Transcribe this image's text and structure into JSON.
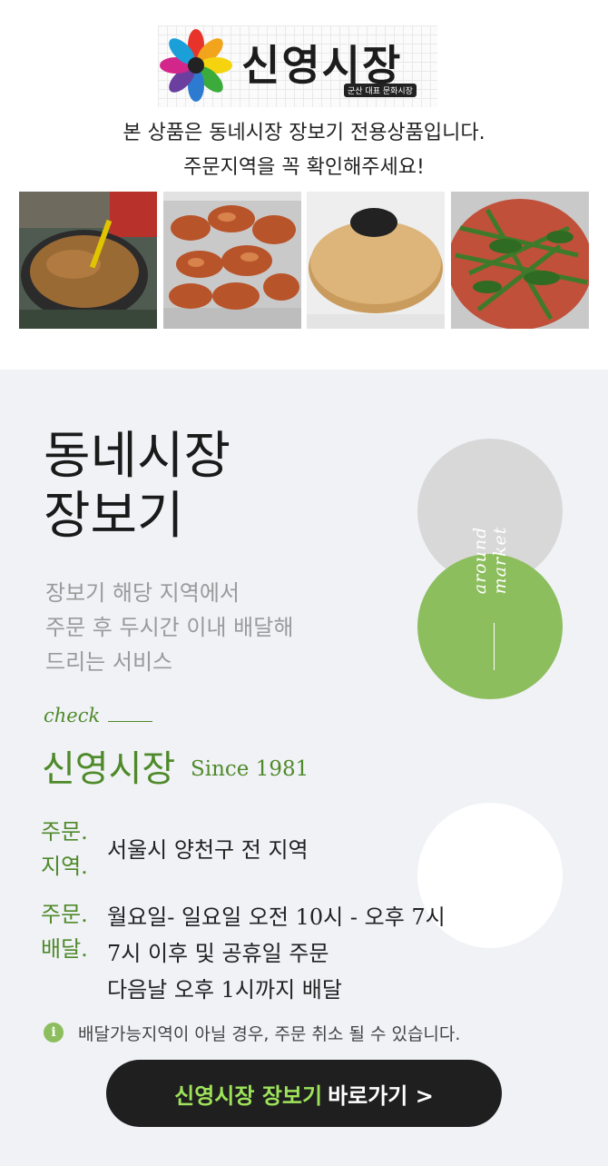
{
  "logo": {
    "text": "신영시장",
    "tag": "군산 대표 문화시장"
  },
  "notice": {
    "line1": "본 상품은 동네시장 장보기 전용상품입니다.",
    "line2": "주문지역을 꼭 확인해주세요!"
  },
  "photos": [
    "seasoning-paste",
    "fried-chicken-gangjeong",
    "sesame-bread",
    "greens-kimchi"
  ],
  "headline": {
    "line1": "동네시장",
    "line2": "장보기"
  },
  "description": [
    "장보기 해당 지역에서",
    "주문 후 두시간 이내 배달해",
    "드리는 서비스"
  ],
  "side_label": "around market",
  "check": "check",
  "market": {
    "name": "신영시장",
    "since": "Since 1981"
  },
  "order_area": {
    "label1": "주문.",
    "label2": "지역.",
    "value": "서울시 양천구 전 지역"
  },
  "delivery": {
    "label1": "주문.",
    "label2": "배달.",
    "lines": [
      "월요일- 일요일 오전 10시 - 오후 7시",
      "7시 이후 및 공휴일 주문",
      "다음날 오후 1시까지 배달"
    ]
  },
  "info": {
    "icon": "i",
    "text": "배달가능지역이 아닐 경우, 주문 취소 될 수 있습니다."
  },
  "cta": {
    "highlight": "신영시장 장보기",
    "rest": "바로가기 >"
  },
  "colors": {
    "accent": "#4f8a2a",
    "green_circle": "#8cbe5d",
    "cta_highlight": "#9ee35a",
    "bg": "#f0f2f6"
  }
}
